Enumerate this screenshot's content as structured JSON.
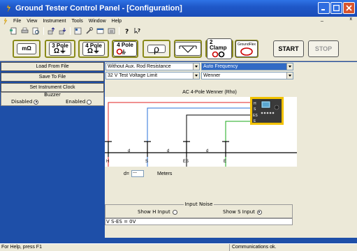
{
  "window": {
    "title": "Ground Tester Control Panel - [Configuration]"
  },
  "menu": {
    "items": [
      "File",
      "View",
      "Instrument",
      "Tools",
      "Window",
      "Help"
    ],
    "mdi_controls": "_       x"
  },
  "mode_buttons": {
    "mohm": "mΩ",
    "pole3_top": "3 Pole",
    "pole3_sym": "Ω⏚",
    "pole4_top": "4 Pole",
    "pole4_sym": "Ω⏚",
    "pole4b_top": "4 Pole",
    "rho": "ρ",
    "volt": "V",
    "clamp2_top": "2 Clamp",
    "groundflex": "GroundFlex",
    "start": "START",
    "stop": "STOP"
  },
  "left_panel": {
    "load": "Load From File",
    "save": "Save To File",
    "set_clock": "Set Instrument Clock",
    "buzzer": {
      "title": "Buzzer",
      "disabled": "Disabled",
      "enabled": "Enabled",
      "selected": "Disabled"
    }
  },
  "dropdowns": {
    "rod_resistance": "Without Aux. Rod Resistance",
    "frequency": "Auto Frequency",
    "voltage_limit": "32 V Test Voltage Limit",
    "method": "Wenner"
  },
  "diagram": {
    "title": "AC 4-Pole Wenner (Rho)",
    "stake_labels": [
      "H",
      "S",
      "ES",
      "E"
    ],
    "spacing_label": "d",
    "device_labels": [
      "H",
      "S",
      "ES",
      "E"
    ],
    "colors": {
      "H": "#e02020",
      "S": "#2a70d8",
      "ES": "#000000",
      "E": "#18a818"
    }
  },
  "distance": {
    "label": "d=",
    "value": "---",
    "units": "Meters"
  },
  "input_noise": {
    "title": "Input Noise",
    "show_h": "Show H Input",
    "show_s": "Show S Input",
    "selected": "Show S Input"
  },
  "readout": "V S-ES = 0V",
  "status": {
    "help": "For Help, press F1",
    "comms": "Communications ok."
  }
}
